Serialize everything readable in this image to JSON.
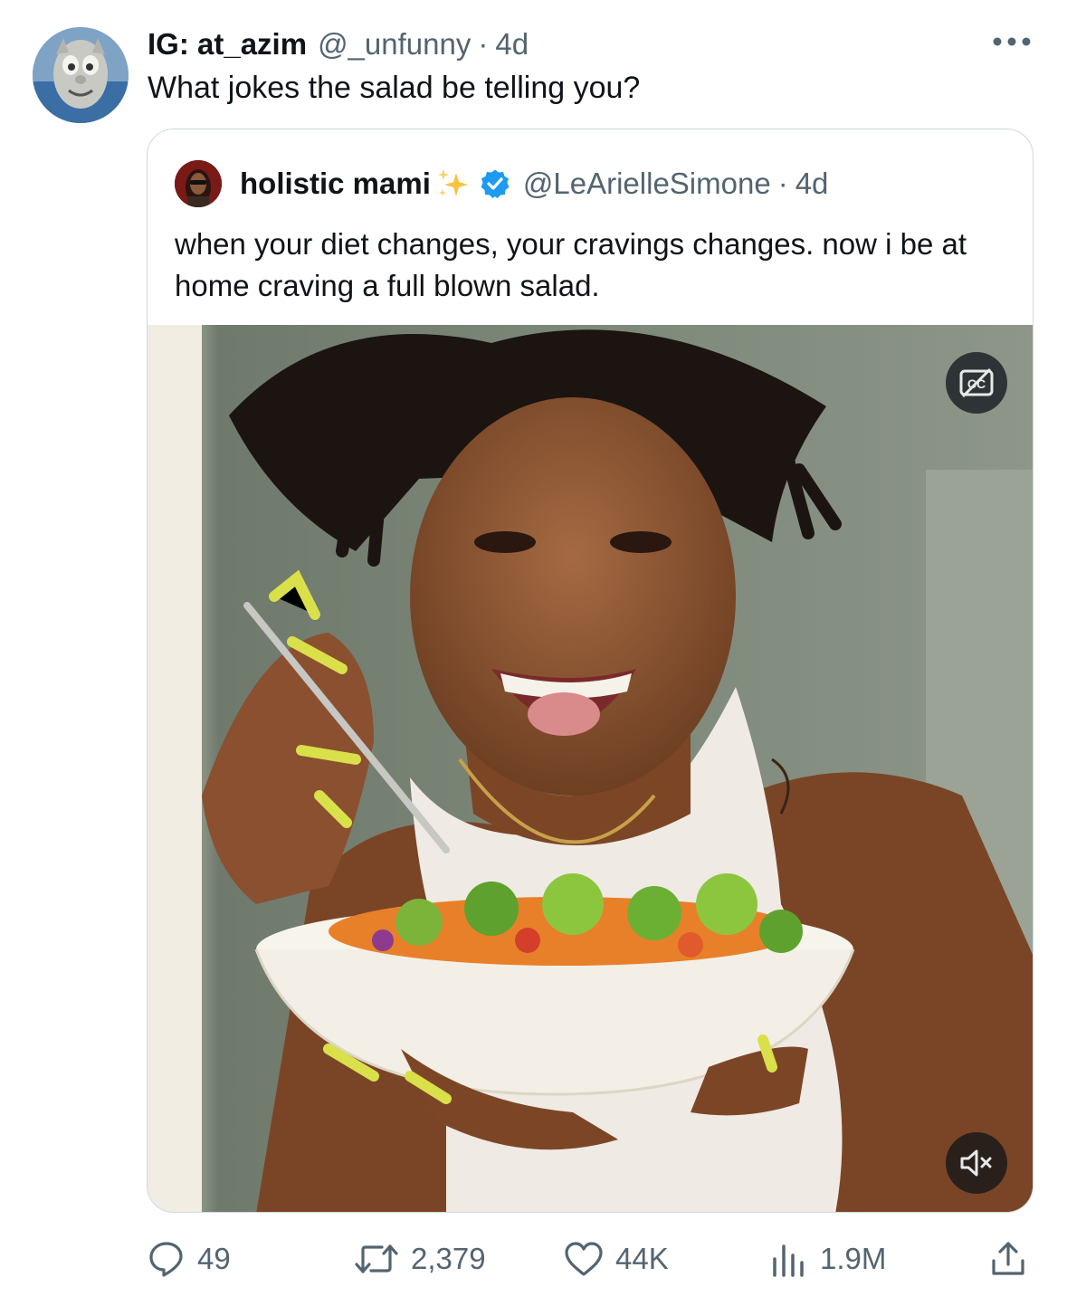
{
  "tweet": {
    "author_name": "IG: at_azim",
    "author_handle": "@_unfunny",
    "separator": "·",
    "time": "4d",
    "text": "What jokes the salad be telling you?",
    "more_icon": "more-horizontal-icon"
  },
  "quote": {
    "author_name": "holistic mami",
    "author_handle": "@LeArielleSimone",
    "separator": "·",
    "time": "4d",
    "text": "when your diet changes, your cravings changes. now i be at home craving a full blown salad.",
    "verified_color": "#1d9bf0",
    "sparkle_color": "#f5c542",
    "media_controls": [
      "captions-icon",
      "volume-muted-icon"
    ]
  },
  "actions": {
    "replies": "49",
    "reposts": "2,379",
    "likes": "44K",
    "views": "1.9M"
  },
  "colors": {
    "text": "#0f1419",
    "secondary": "#536471",
    "border": "#cfd9de",
    "accent": "#1d9bf0"
  }
}
